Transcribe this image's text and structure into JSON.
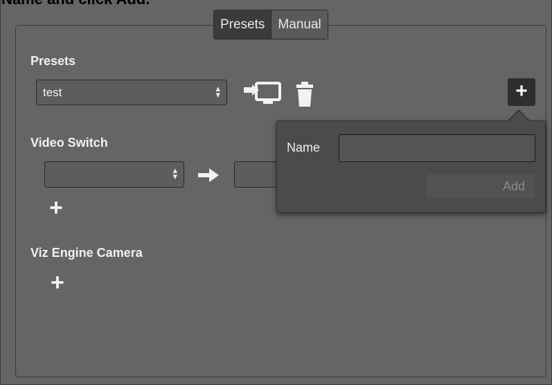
{
  "caption": {
    "text": "Name and click Add."
  },
  "tabs": [
    {
      "label": "Presets",
      "active": true
    },
    {
      "label": "Manual",
      "active": false
    }
  ],
  "presets": {
    "section_label": "Presets",
    "selected_value": "test",
    "icons": [
      "apply-preset-icon",
      "trash-icon"
    ],
    "add_label": "+"
  },
  "video_switch": {
    "section_label": "Video Switch",
    "source_value": "",
    "arrow_icon": "arrow-right-icon",
    "add_label": "+"
  },
  "viz_engine_camera": {
    "section_label": "Viz Engine Camera",
    "add_label": "+"
  },
  "popup": {
    "name_label": "Name",
    "name_value": "",
    "add_button_label": "Add"
  },
  "colors": {
    "panel_bg": "#656565",
    "popup_bg": "#4b4b4b",
    "active_tab_bg": "#3b3b3b"
  }
}
